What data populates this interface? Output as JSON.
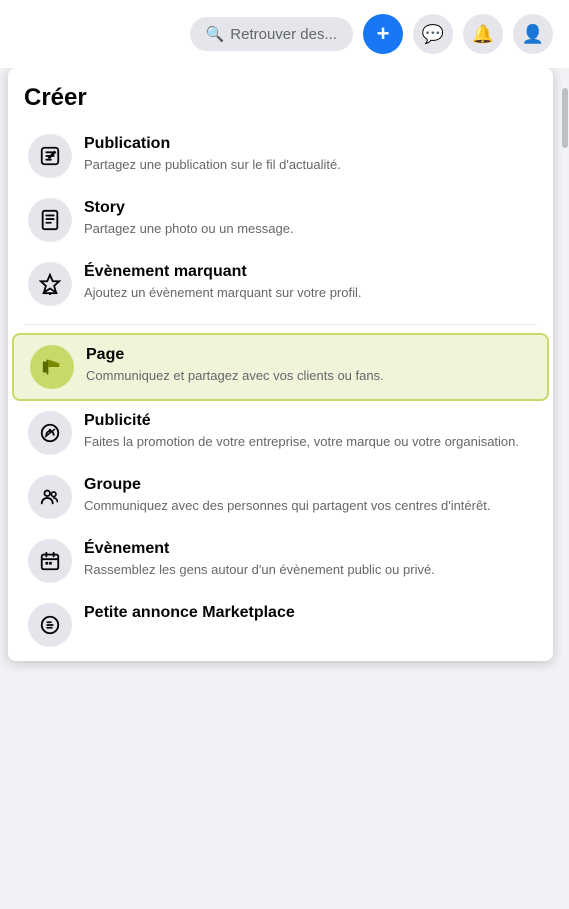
{
  "topbar": {
    "search_label": "Retrouver des...",
    "plus_label": "+",
    "messenger_icon": "💬",
    "bell_icon": "🔔",
    "avatar_icon": "👤"
  },
  "panel": {
    "title": "Créer",
    "items": [
      {
        "id": "publication",
        "title": "Publication",
        "desc": "Partagez une publication sur le fil d'actualité.",
        "icon": "✏️",
        "highlighted": false
      },
      {
        "id": "story",
        "title": "Story",
        "desc": "Partagez une photo ou un message.",
        "icon": "📖",
        "highlighted": false
      },
      {
        "id": "evenement-marquant",
        "title": "Évènement marquant",
        "desc": "Ajoutez un évènement marquant sur votre profil.",
        "icon": "⭐",
        "highlighted": false
      },
      {
        "id": "page",
        "title": "Page",
        "desc": "Communiquez et partagez avec vos clients ou fans.",
        "icon": "🚩",
        "highlighted": true
      },
      {
        "id": "publicite",
        "title": "Publicité",
        "desc": "Faites la promotion de votre entreprise, votre marque ou votre organisation.",
        "icon": "📣",
        "highlighted": false
      },
      {
        "id": "groupe",
        "title": "Groupe",
        "desc": "Communiquez avec des personnes qui partagent vos centres d'intérêt.",
        "icon": "👥",
        "highlighted": false
      },
      {
        "id": "evenement",
        "title": "Évènement",
        "desc": "Rassemblez les gens autour d'un évènement public ou privé.",
        "icon": "🗓️",
        "highlighted": false
      },
      {
        "id": "petite-annonce",
        "title": "Petite annonce Marketplace",
        "desc": "",
        "icon": "🏷️",
        "highlighted": false
      }
    ]
  }
}
